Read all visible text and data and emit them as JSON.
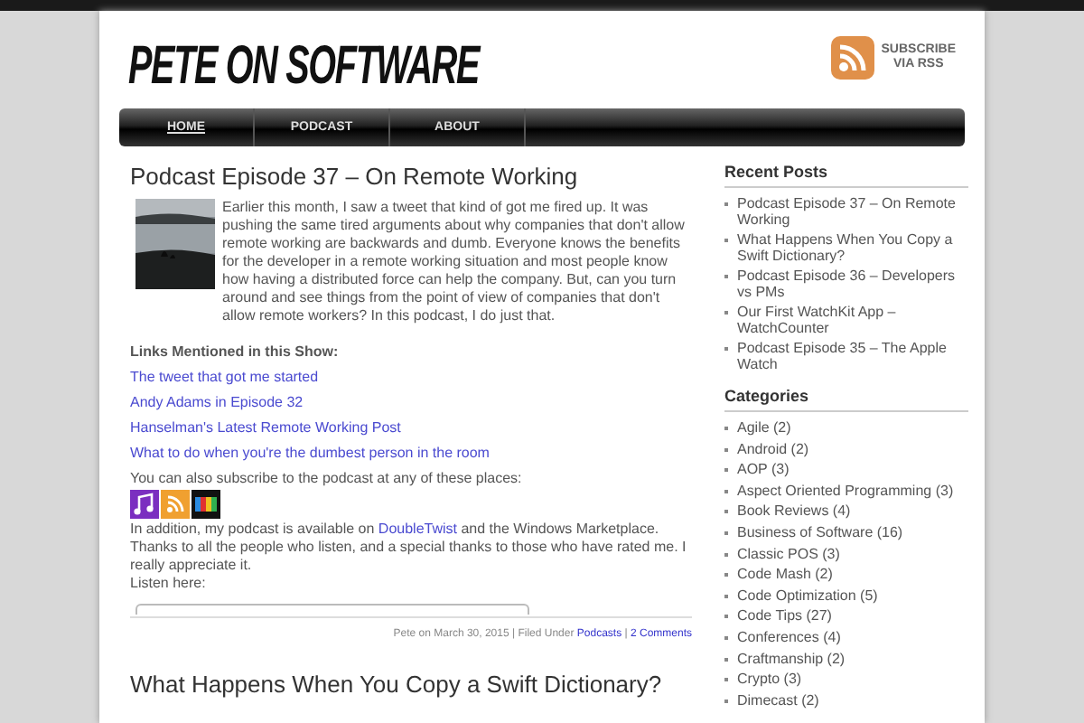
{
  "site": {
    "title": "PETE ON SOFTWARE",
    "subscribe": [
      "SUBSCRIBE",
      "VIA RSS"
    ]
  },
  "nav": [
    {
      "label": "HOME",
      "selected": true
    },
    {
      "label": "PODCAST",
      "selected": false
    },
    {
      "label": "ABOUT",
      "selected": false
    }
  ],
  "posts": [
    {
      "title": "Podcast Episode 37 – On Remote Working",
      "intro": "Earlier this month, I saw a tweet that kind of got me fired up. It was pushing the same tired arguments about why companies that don't allow remote working are backwards and dumb. Everyone knows the benefits for the developer in a remote working situation and most people know how having a distributed force can help the company. But, can you turn around and see things from the point of view of companies that don't allow remote workers? In this podcast, I do just that.",
      "links_heading": "Links Mentioned in this Show:",
      "links": [
        "The tweet that got me started",
        "Andy Adams in Episode 32",
        "Hanselman's Latest Remote Working Post",
        "What to do when you're the dumbest person in the room"
      ],
      "subscribe_text": "You can also subscribe to the podcast at any of these places:",
      "availability": {
        "before": "In addition, my podcast is available on ",
        "link": "DoubleTwist",
        "after": " and the Windows Marketplace."
      },
      "thanks": "Thanks to all the people who listen, and a special thanks to those who have rated me. I really appreciate it.",
      "listen": "Listen here:",
      "meta": {
        "byline": "Pete on March 30, 2015 | Filed Under ",
        "category": "Podcasts",
        "separator": " | ",
        "comments": "2 Comments"
      }
    },
    {
      "title": "What Happens When You Copy a Swift Dictionary?"
    }
  ],
  "sidebar": [
    {
      "heading": "Recent Posts",
      "items": [
        "Podcast Episode 37 – On Remote Working",
        "What Happens When You Copy a Swift Dictionary?",
        "Podcast Episode 36 – Developers vs PMs",
        "Our First WatchKit App – WatchCounter",
        "Podcast Episode 35 – The Apple Watch"
      ]
    },
    {
      "heading": "Categories",
      "items": [
        "Agile (2)",
        "Android (2)",
        "AOP (3)",
        "Aspect Oriented Programming (3)",
        "Book Reviews (4)",
        "Business of Software (16)",
        "Classic POS (3)",
        "Code Mash (2)",
        "Code Optimization (5)",
        "Code Tips (27)",
        "Conferences (4)",
        "Craftmanship (2)",
        "Crypto (3)",
        "Dimecast (2)"
      ]
    }
  ]
}
